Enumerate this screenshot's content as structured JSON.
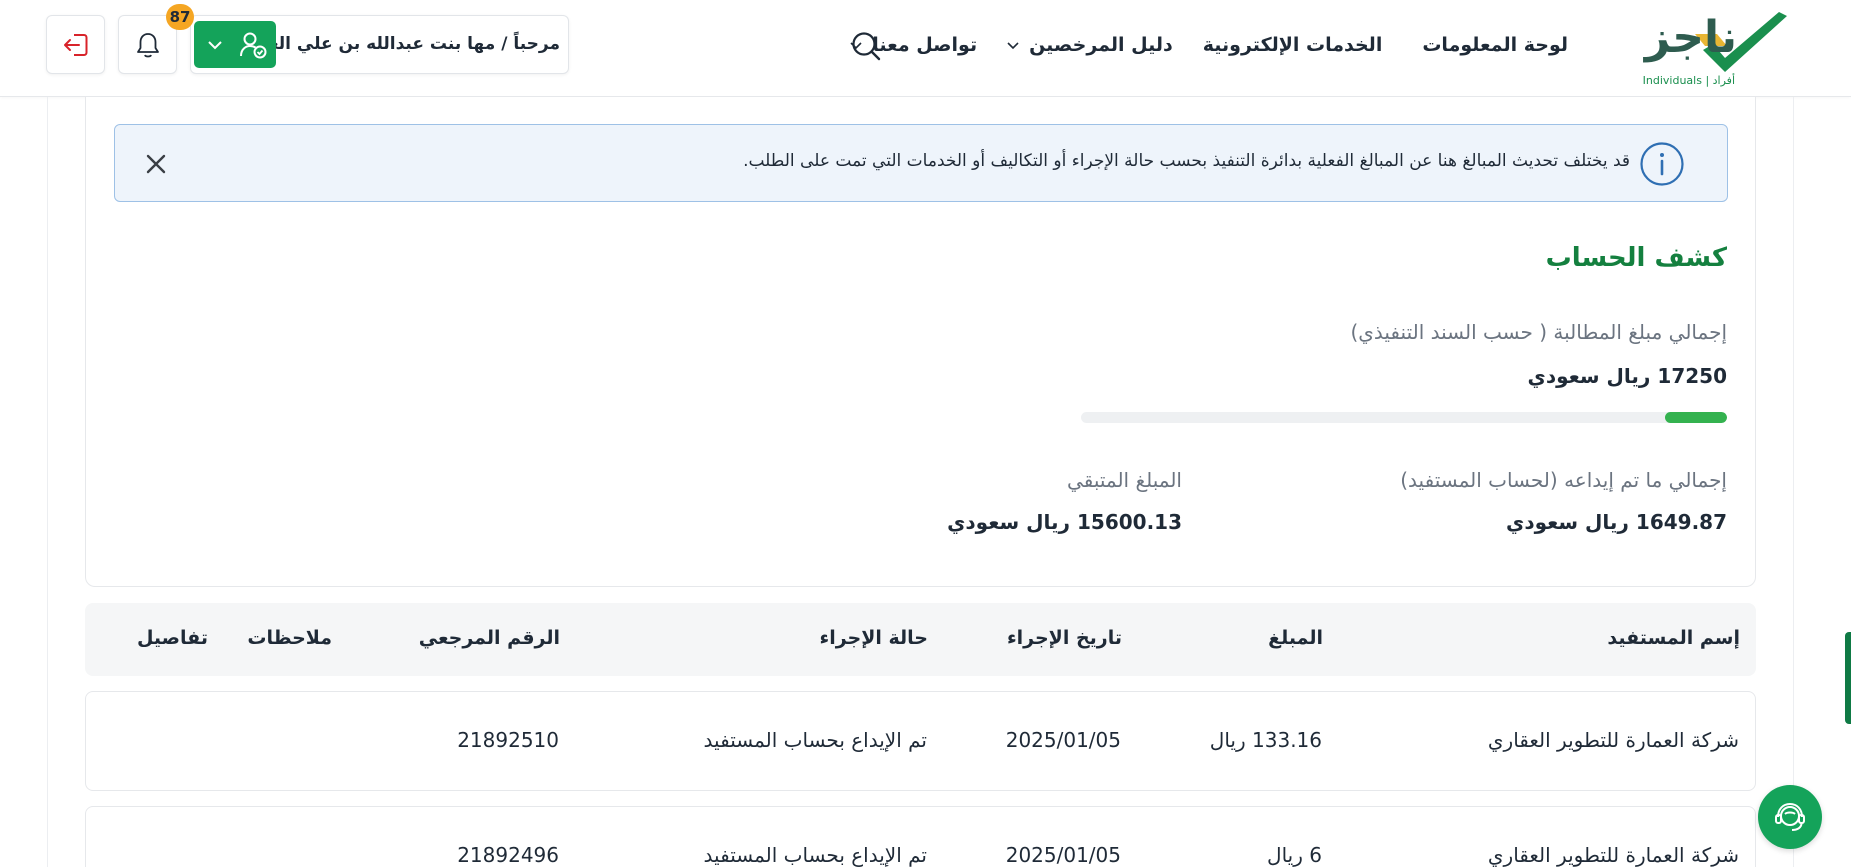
{
  "header": {
    "logo": {
      "name": "ناجز",
      "subtitle": "Individuals | أفراد"
    },
    "nav": [
      {
        "label": "لوحة المعلومات"
      },
      {
        "label": "الخدمات الإلكترونية"
      },
      {
        "label": "دليل المرخصين"
      },
      {
        "label": "تواصل معنا"
      }
    ],
    "user": {
      "greeting": "مرحباً / مها بنت عبدالله بن علي الغريبي"
    },
    "notifications_count": "87"
  },
  "alert": {
    "text": "قد يختلف تحديث المبالغ هنا عن المبالغ الفعلية بدائرة التنفيذ بحسب حالة الإجراء أو التكاليف أو الخدمات التي تمت على الطلب."
  },
  "statement": {
    "title": "كشف الحساب",
    "total_label": "إجمالي مبلغ المطالبة ( حسب السند التنفيذي)",
    "total_value": "17250 ريال سعودي",
    "progress_fraction": 0.0956,
    "deposited_label": "إجمالي ما تم إيداعه (لحساب المستفيد)",
    "deposited_value": "1649.87 ريال سعودي",
    "remaining_label": "المبلغ المتبقي",
    "remaining_value": "15600.13 ريال سعودي"
  },
  "table": {
    "headers": {
      "name": "إسم المستفيد",
      "amount": "المبلغ",
      "date": "تاريخ الإجراء",
      "status": "حالة الإجراء",
      "ref": "الرقم المرجعي",
      "notes": "ملاحظات",
      "details": "تفاصيل"
    },
    "rows": [
      {
        "name": "شركة العمارة للتطوير العقاري",
        "amount": "133.16 ريال",
        "date": "2025/01/05",
        "status": "تم الإيداع بحساب المستفيد",
        "ref": "21892510"
      },
      {
        "name": "شركة العمارة للتطوير العقاري",
        "amount": "6 ريال",
        "date": "2025/01/05",
        "status": "تم الإيداع بحساب المستفيد",
        "ref": "21892496"
      }
    ]
  },
  "colors": {
    "brand_green": "#14a35a",
    "title_green": "#14803f",
    "alert_bg": "#eef4fb",
    "alert_border": "#9ec1e6",
    "badge": "#f5a623",
    "logout_red": "#d8232a"
  },
  "icons": {
    "logo": "check-mark-logo-icon",
    "search": "search-icon",
    "chevron": "chevron-down-icon",
    "user": "user-check-icon",
    "bell": "bell-icon",
    "logout": "logout-icon",
    "info": "info-icon",
    "close": "close-icon",
    "chat": "support-agent-icon"
  }
}
